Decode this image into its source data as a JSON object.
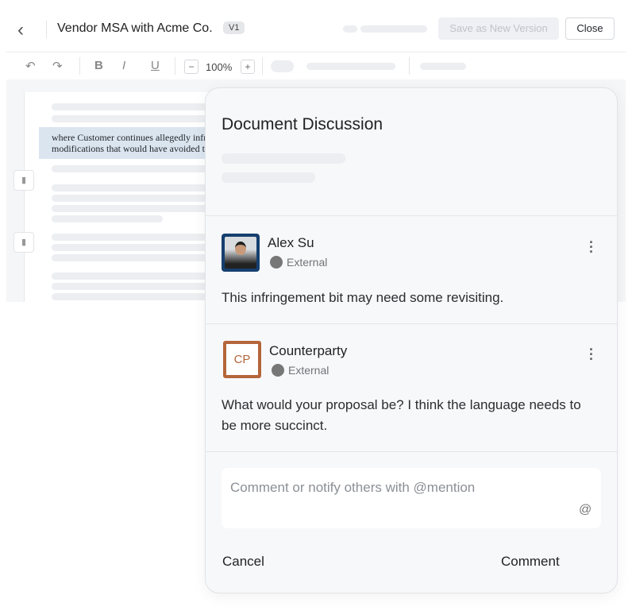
{
  "header": {
    "title": "Vendor MSA with Acme Co.",
    "version": "V1",
    "save_label": "Save as New Version",
    "close_label": "Close"
  },
  "toolbar": {
    "zoom": "100%",
    "zoom_out": "−",
    "zoom_in": "+",
    "bold": "B",
    "italic": "I",
    "underline": "U"
  },
  "document": {
    "highlight_lines": [
      "where Customer continues allegedly infringing",
      "modifications that would have avoided the"
    ]
  },
  "discussion": {
    "title": "Document Discussion",
    "comments": [
      {
        "author": "Alex Su",
        "role": "External",
        "text": "This infringement bit may need some revisiting.",
        "avatar_color": "#163f6e"
      },
      {
        "author": "Counterparty",
        "initials": "CP",
        "role": "External",
        "text": "What would your proposal be? I think the language needs to be more succinct.",
        "avatar_color": "#b5653a"
      }
    ],
    "input_placeholder": "Comment or notify others with @mention",
    "at_symbol": "@",
    "cancel_label": "Cancel",
    "comment_label": "Comment"
  }
}
